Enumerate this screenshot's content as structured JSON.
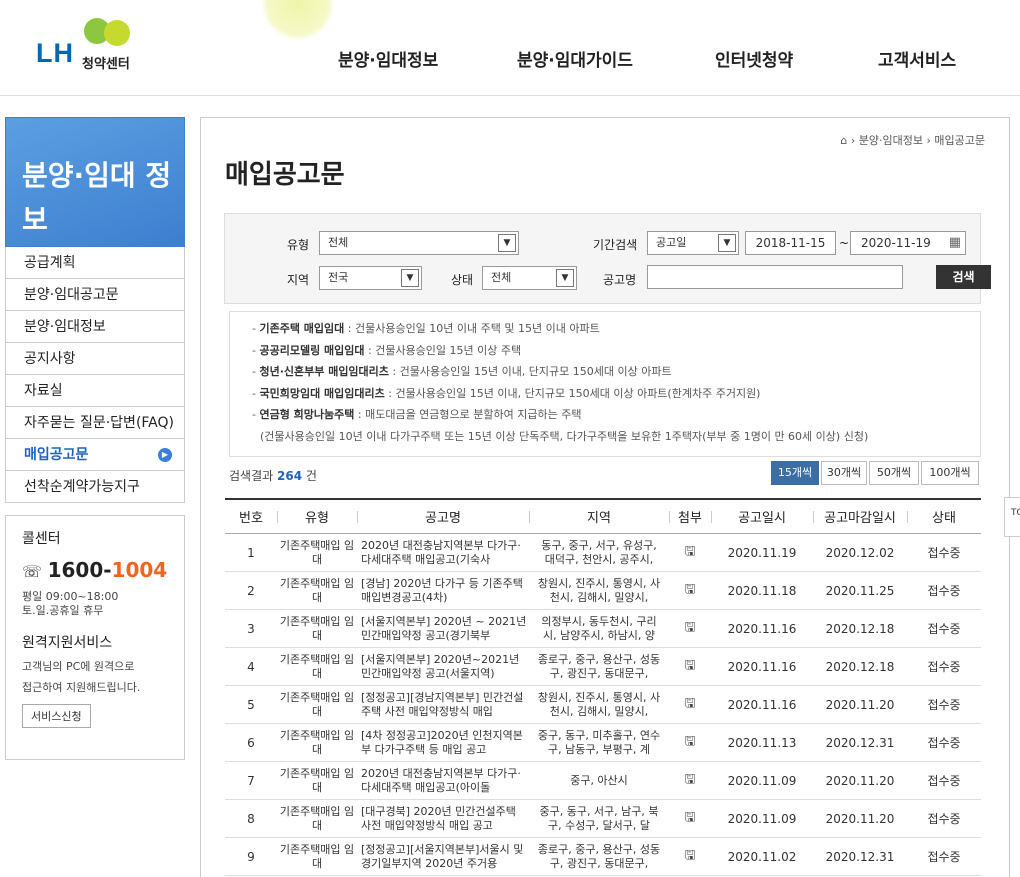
{
  "header": {
    "logo_text": "LH",
    "logo_sub": "청약센터",
    "nav": [
      "분양·임대정보",
      "분양·임대가이드",
      "인터넷청약",
      "고객서비스"
    ]
  },
  "sidebar": {
    "title": "분양·임대 정보",
    "items": [
      {
        "label": "공급계획"
      },
      {
        "label": "분양·임대공고문"
      },
      {
        "label": "분양·임대정보"
      },
      {
        "label": "공지사항"
      },
      {
        "label": "자료실"
      },
      {
        "label": "자주묻는 질문·답변(FAQ)"
      },
      {
        "label": "매입공고문"
      },
      {
        "label": "선착순계약가능지구"
      }
    ],
    "active_index": 6,
    "callcenter": {
      "title": "콜센터",
      "phone_prefix": "1600-",
      "phone_suffix": "1004",
      "hours": "평일 09:00~18:00",
      "holiday": "토.일.공휴일 휴무"
    },
    "remote": {
      "title": "원격지원서비스",
      "desc1": "고객님의 PC에 원격으로",
      "desc2": "접근하여 지원해드립니다.",
      "button": "서비스신청"
    }
  },
  "breadcrumb": {
    "items": [
      "분양·임대정보",
      "매입공고문"
    ]
  },
  "page_title": "매입공고문",
  "search": {
    "type_label": "유형",
    "type_value": "전체",
    "region_label": "지역",
    "region_value": "전국",
    "status_label": "상태",
    "status_value": "전체",
    "period_label": "기간검색",
    "period_value": "공고일",
    "date_from": "2018-11-15",
    "date_tilde": "~",
    "date_to": "2020-11-19",
    "name_label": "공고명",
    "name_value": "",
    "button": "검색"
  },
  "notice": {
    "lines": [
      {
        "bold": "기존주택 매입임대",
        "text": " : 건물사용승인일 10년 이내 주택 및 15년 이내 아파트"
      },
      {
        "bold": "공공리모델링 매입임대",
        "text": " : 건물사용승인일 15년 이상 주택"
      },
      {
        "bold": "청년·신혼부부 매입임대리츠",
        "text": " : 건물사용승인일 15년 이내, 단지규모 150세대 이상 아파트"
      },
      {
        "bold": "국민희망임대 매입임대리츠",
        "text": " : 건물사용승인일 15년 이내, 단지규모 150세대 이상 아파트(한계차주 주거지원)"
      },
      {
        "bold": "연금형 희망나눔주택",
        "text": " : 매도대금을 연금형으로 분할하여 지급하는 주택"
      },
      {
        "bold": "",
        "text": "(건물사용승인일 10년 이내 다가구주택 또는 15년 이상 단독주택, 다가구주택을 보유한 1주택자(부부 중 1명이 만 60세 이상) 신청)"
      }
    ]
  },
  "results": {
    "prefix": "검색결과",
    "count": "264",
    "suffix": "건",
    "page_sizes": [
      "15개씩",
      "30개씩",
      "50개씩",
      "100개씩"
    ],
    "selected_size_index": 0
  },
  "table": {
    "headers": [
      "번호",
      "유형",
      "공고명",
      "지역",
      "첨부",
      "공고일시",
      "공고마감일시",
      "상태"
    ],
    "rows": [
      {
        "no": "1",
        "type": "기존주택매입 임대",
        "title": "2020년 대전충남지역본부 다가구·다세대주택 매입공고(기숙사",
        "region": "동구, 중구, 서구, 유성구, 대덕구, 천안시, 공주시,",
        "date": "2020.11.19",
        "deadline": "2020.12.02",
        "status": "접수중"
      },
      {
        "no": "2",
        "type": "기존주택매입 임대",
        "title": "[경남] 2020년 다가구 등 기존주택 매입변경공고(4차)",
        "region": "창원시, 진주시, 통영시, 사천시, 김해시, 밀양시,",
        "date": "2020.11.18",
        "deadline": "2020.11.25",
        "status": "접수중"
      },
      {
        "no": "3",
        "type": "기존주택매입 임대",
        "title": "[서울지역본부] 2020년 ~ 2021년 민간매입약정 공고(경기북부",
        "region": "의정부시, 동두천시, 구리시, 남양주시, 하남시, 양",
        "date": "2020.11.16",
        "deadline": "2020.12.18",
        "status": "접수중"
      },
      {
        "no": "4",
        "type": "기존주택매입 임대",
        "title": "[서울지역본부] 2020년~2021년 민간매입약정 공고(서울지역)",
        "region": "종로구, 중구, 용산구, 성동구, 광진구, 동대문구,",
        "date": "2020.11.16",
        "deadline": "2020.12.18",
        "status": "접수중"
      },
      {
        "no": "5",
        "type": "기존주택매입 임대",
        "title": "[정정공고][경남지역본부] 민간건설주택 사전 매입약정방식 매입",
        "region": "창원시, 진주시, 통영시, 사천시, 김해시, 밀양시,",
        "date": "2020.11.16",
        "deadline": "2020.11.20",
        "status": "접수중"
      },
      {
        "no": "6",
        "type": "기존주택매입 임대",
        "title": "[4차 정정공고]2020년 인천지역본부 다가구주택 등 매입 공고",
        "region": "중구, 동구, 미추홀구, 연수구, 남동구, 부평구, 계",
        "date": "2020.11.13",
        "deadline": "2020.12.31",
        "status": "접수중"
      },
      {
        "no": "7",
        "type": "기존주택매입 임대",
        "title": "2020년 대전충남지역본부 다가구·다세대주택 매입공고(아이돌",
        "region": "중구, 아산시",
        "date": "2020.11.09",
        "deadline": "2020.11.20",
        "status": "접수중"
      },
      {
        "no": "8",
        "type": "기존주택매입 임대",
        "title": "[대구경북] 2020년 민간건설주택 사전 매입약정방식 매입 공고",
        "region": "중구, 동구, 서구, 남구, 북구, 수성구, 달서구, 달",
        "date": "2020.11.09",
        "deadline": "2020.11.20",
        "status": "접수중"
      },
      {
        "no": "9",
        "type": "기존주택매입 임대",
        "title": "[정정공고][서울지역본부]서울시 및 경기일부지역 2020년 주거용",
        "region": "종로구, 중구, 용산구, 성동구, 광진구, 동대문구,",
        "date": "2020.11.02",
        "deadline": "2020.12.31",
        "status": "접수중"
      }
    ]
  },
  "edge_tab": "TO"
}
